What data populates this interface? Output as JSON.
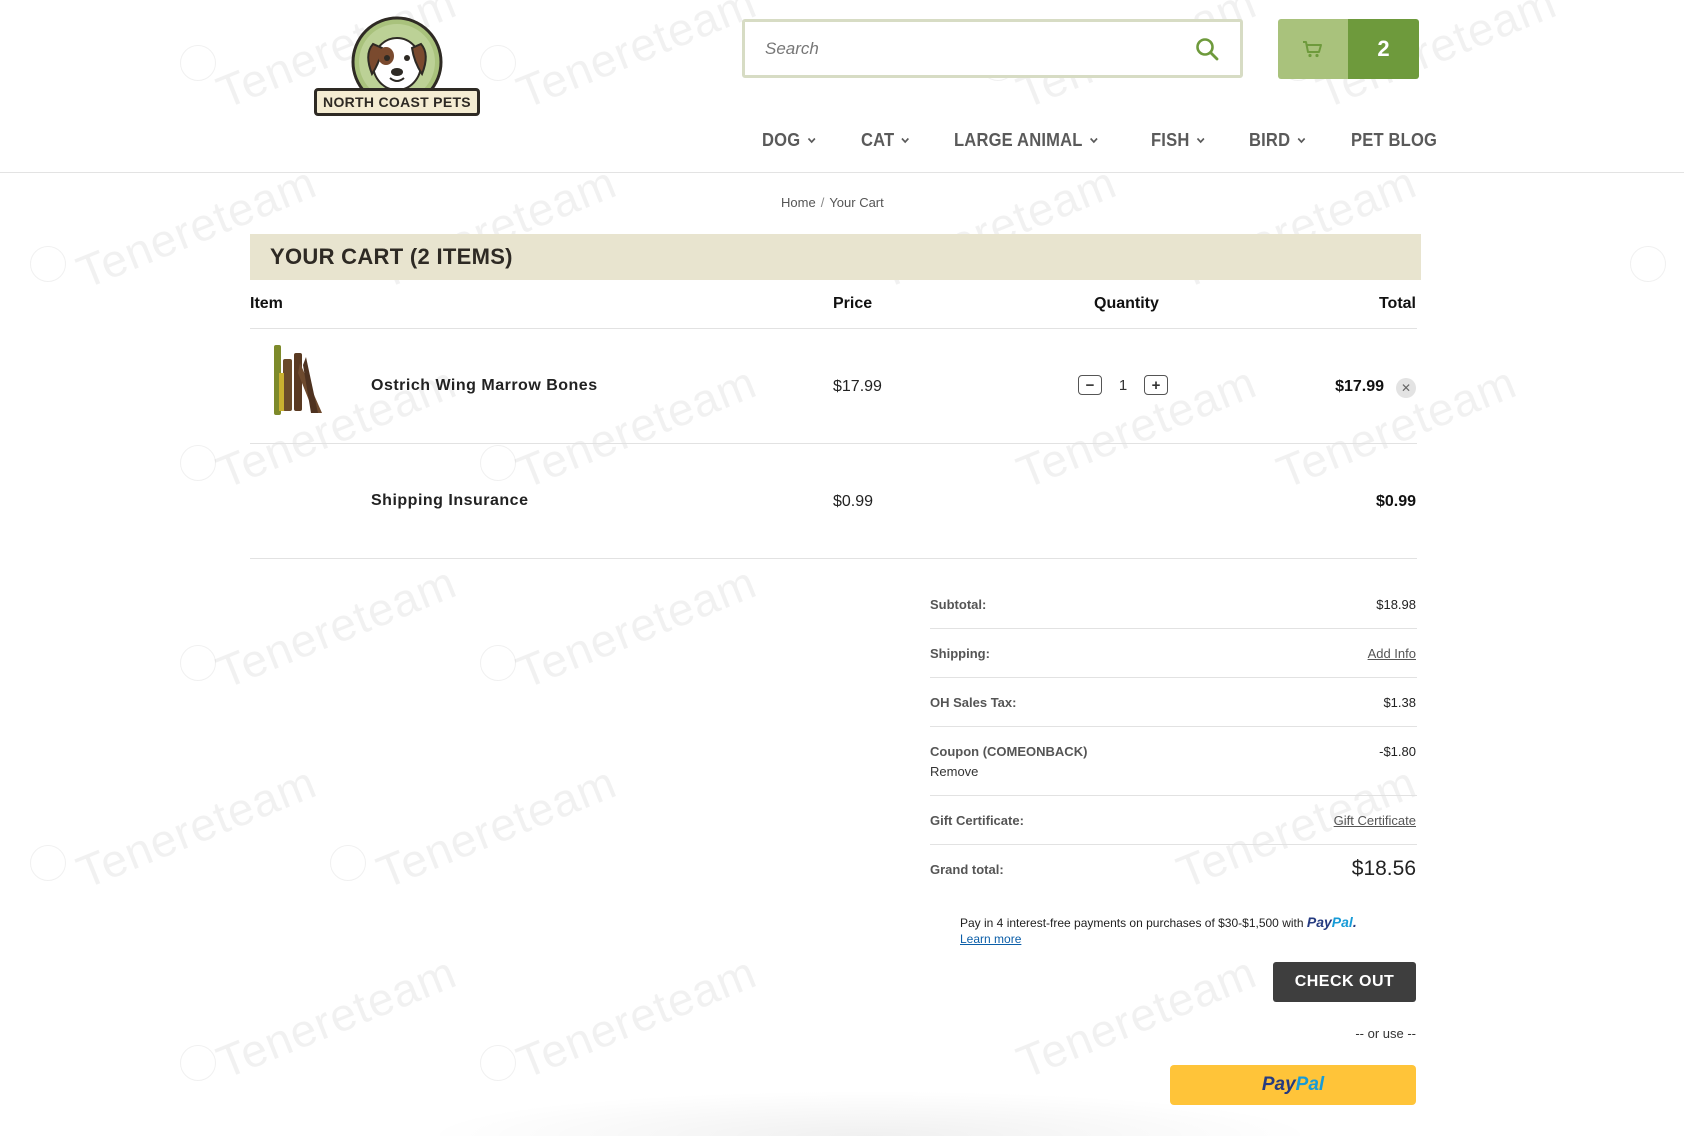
{
  "header": {
    "logo_text": "NORTH COAST PETS",
    "search": {
      "placeholder": "Search",
      "icon": "search-icon"
    },
    "cart": {
      "icon": "cart-icon",
      "count": "2"
    }
  },
  "nav": {
    "items": [
      {
        "label": "DOG",
        "has_dropdown": true
      },
      {
        "label": "CAT",
        "has_dropdown": true
      },
      {
        "label": "LARGE ANIMAL",
        "has_dropdown": true
      },
      {
        "label": "FISH",
        "has_dropdown": true
      },
      {
        "label": "BIRD",
        "has_dropdown": true
      },
      {
        "label": "PET BLOG",
        "has_dropdown": false
      }
    ]
  },
  "breadcrumb": {
    "home": "Home",
    "separator": "/",
    "current": "Your Cart"
  },
  "cart": {
    "title": "YOUR CART (2 ITEMS)",
    "columns": {
      "item": "Item",
      "price": "Price",
      "quantity": "Quantity",
      "total": "Total"
    },
    "items": [
      {
        "name": "Ostrich Wing Marrow Bones",
        "price": "$17.99",
        "quantity": "1",
        "total": "$17.99",
        "remove_icon": "close-icon",
        "minus_icon": "minus-icon",
        "plus_icon": "plus-icon"
      },
      {
        "name": "Shipping Insurance",
        "price": "$0.99",
        "total": "$0.99"
      }
    ]
  },
  "totals": {
    "subtotal_label": "Subtotal:",
    "subtotal_value": "$18.98",
    "shipping_label": "Shipping:",
    "shipping_link": "Add Info",
    "tax_label": "OH Sales Tax:",
    "tax_value": "$1.38",
    "coupon_label": "Coupon (COMEONBACK)",
    "coupon_remove": "Remove",
    "coupon_value": "-$1.80",
    "gift_label": "Gift Certificate:",
    "gift_link": "Gift Certificate",
    "grand_label": "Grand total:",
    "grand_value": "$18.56"
  },
  "paypal_message": {
    "text": "Pay in 4 interest-free payments on purchases of $30-$1,500 with",
    "brand_a": "Pay",
    "brand_b": "Pal",
    "learn_more": "Learn more"
  },
  "actions": {
    "checkout": "CHECK OUT",
    "or_use": "-- or use --",
    "paypal_a": "Pay",
    "paypal_b": "Pal"
  },
  "watermark": {
    "text": "Tenereteam"
  },
  "colors": {
    "title_bar_bg": "#e8e4cf",
    "cart_light": "#a9c27c",
    "cart_dark": "#6e9a3c",
    "checkout_bg": "#3e3e3e",
    "paypal_yellow": "#ffc439"
  }
}
